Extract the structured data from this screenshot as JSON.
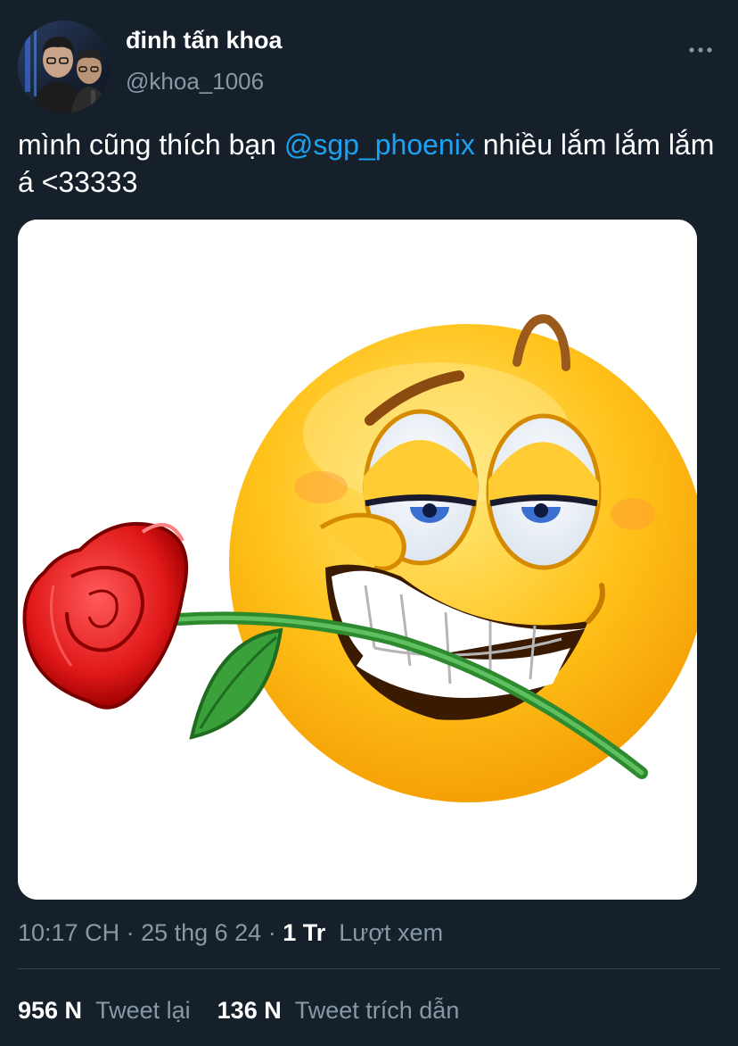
{
  "author": {
    "display_name": "đinh tấn khoa",
    "handle": "@khoa_1006",
    "avatar_icon": "profile-photo"
  },
  "more_icon": "more-horizontal-icon",
  "tweet": {
    "text_before": "mình cũng thích bạn ",
    "mention": "@sgp_phoenix",
    "text_after": " nhiều lắm lắm lắm á <33333"
  },
  "media": {
    "description_icon": "smiley-with-rose-image"
  },
  "meta": {
    "time": "10:17 CH",
    "date": "25 thg 6 24",
    "views_count": "1 Tr",
    "views_label": "Lượt xem"
  },
  "stats": {
    "retweets_count": "956 N",
    "retweets_label": "Tweet lại",
    "quotes_count": "136 N",
    "quotes_label": "Tweet trích dẫn"
  },
  "colors": {
    "background": "#15202b",
    "accent": "#1da1f2",
    "secondary_text": "#8899a6",
    "divider": "#38444d"
  }
}
